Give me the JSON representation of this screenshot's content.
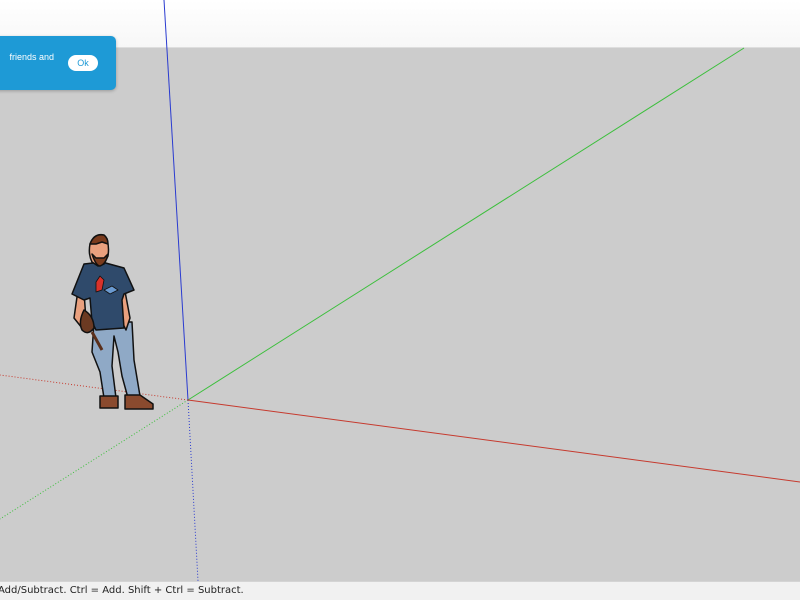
{
  "notification": {
    "message": "friends and",
    "ok_label": "Ok"
  },
  "status_bar": {
    "text": "Add/Subtract. Ctrl = Add. Shift + Ctrl = Subtract."
  },
  "viewport": {
    "axes": {
      "red": "#c63a2e",
      "green": "#3cbf3c",
      "blue": "#2a3bd0"
    },
    "background": "#cccccc",
    "scale_figure": "person-figure"
  },
  "colors": {
    "notification_bg": "#1e9ad6",
    "status_bar_bg": "#f1f1f1"
  }
}
